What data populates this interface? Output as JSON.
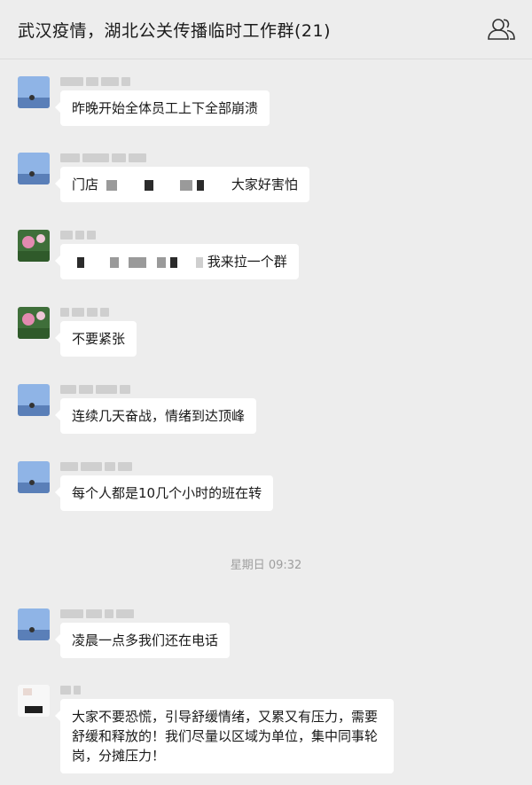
{
  "header": {
    "title": "武汉疫情，湖北公关传播临时工作群(21)",
    "icon": "group-members-icon"
  },
  "messages": [
    {
      "text": "昨晚开始全体员工上下全部崩溃"
    },
    {
      "text_a": "门店",
      "text_b": "大家好害怕"
    },
    {
      "text": "我来拉一个群"
    },
    {
      "text": "不要紧张"
    },
    {
      "text": "连续几天奋战，情绪到达顶峰"
    },
    {
      "text": "每个人都是10几个小时的班在转"
    },
    {
      "text": "凌晨一点多我们还在电话"
    },
    {
      "text": "大家不要恐慌，引导舒缓情绪，又累又有压力，需要舒缓和释放的！我们尽量以区域为单位，集中同事轮岗，分摊压力！"
    }
  ],
  "timestamp": "星期日 09:32",
  "colors": {
    "background": "#ededed",
    "bubble": "#ffffff",
    "timestamp": "#9e9e9e"
  }
}
